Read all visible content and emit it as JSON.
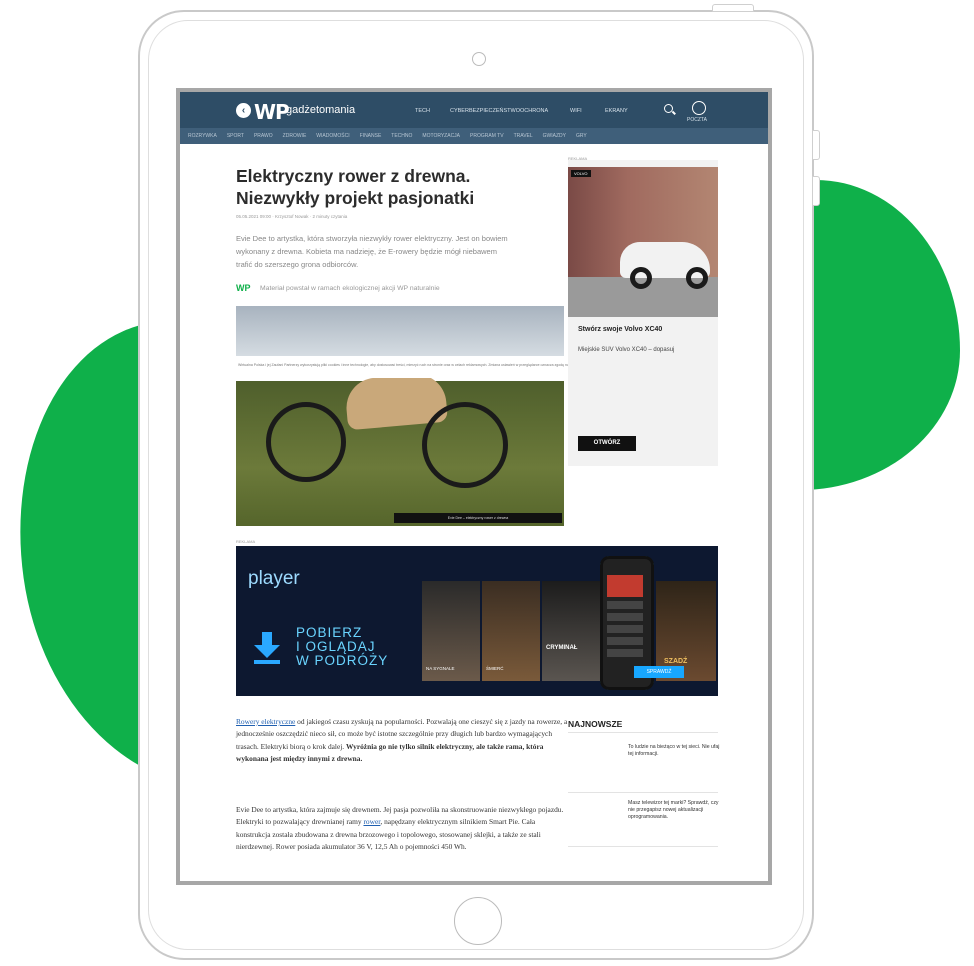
{
  "topbar": {
    "brand": "WP",
    "site_name": "gadżetomania",
    "nav": [
      "TECH",
      "CYBERBEZPIECZEŃSTWO",
      "OCHRONA",
      "WIFI",
      "EKRANY"
    ],
    "poczta": "POCZTA"
  },
  "subnav": [
    "ROZRYWKA",
    "SPORT",
    "PRAWO",
    "ZDROWIE",
    "WIADOMOŚCI",
    "FINANSE",
    "TECHNO",
    "MOTORYZACJA",
    "PROGRAM TV",
    "TRAVEL",
    "GWIAZDY",
    "GRY"
  ],
  "article": {
    "title": "Elektryczny rower z drewna. Niezwykły projekt pasjonatki",
    "meta": "05.05.2021 09:00 · Krzysztof Nowak · 2 minuty czytania",
    "lead": "Evie Dee to artystka, która stworzyła niezwykły rower elektryczny. Jest on bowiem wykonany z drewna. Kobieta ma nadzieję, że E-rowery będzie mógł niebawem trafić do szerszego grona odbiorców.",
    "promo_mark": "WP",
    "promo_text": "Materiał powstał w ramach ekologicznej akcji WP naturalnie",
    "consent_text": "Wirtualna Polska i jej Zaufani Partnerzy wykorzystują pliki cookies i inne technologie, aby dostosować treści, mierzyć ruch na stronie oraz w celach reklamowych. Zmiana ustawień w przeglądarce oznacza zgodę na ich zapisywanie. Szczegóły w Polityce prywatności.",
    "photo_caption": "Evie Dee – elektryczny rower z drewna",
    "body_p1_link": "Rowery elektryczne",
    "body_p1": " od jakiegoś czasu zyskują na popularności. Pozwalają one cieszyć się z jazdy na rowerze, a jednocześnie oszczędzić nieco sił, co może być istotne szczególnie przy długich lub bardzo wymagających trasach. Elektryki biorą o krok dalej. ",
    "body_p1_bold": "Wyróżnia go nie tylko silnik elektryczny, ale także rama, która wykonana jest między innymi z drewna.",
    "body_p2_a": "Evie Dee to artystka, która zajmuje się drewnem. Jej pasja pozwoliła na skonstruowanie niezwykłego pojazdu. Elektryki to pozwalający drewnianej ramy ",
    "body_p2_link": "rower",
    "body_p2_b": ", napędzany elektrycznym silnikiem Smart Pie. Cała konstrukcja została zbudowana z drewna brzozowego i topolowego, stosowanej sklejki, a także ze stali nierdzewnej. Rower posiada akumulator 36 V, 12,5 Ah o pojemności 450 Wh."
  },
  "sidebar_ad": {
    "tag": "REKLAMA",
    "badge": "VOLVO",
    "title": "Stwórz swoje Volvo XC40",
    "text": "Miejskie SUV Volvo XC40 – dopasuj",
    "cta": "OTWÓRZ"
  },
  "banner": {
    "tag": "REKLAMA",
    "logo": "player",
    "line1": "POBIERZ",
    "line2": "I OGLĄDAJ",
    "line3": "W PODRÓŻY",
    "poster1": "NA SYGNALE",
    "poster2": "ŚMIERĆ",
    "poster3": "CRYMINAŁ",
    "poster4": "SZADŹ",
    "cta": "SPRAWDŹ"
  },
  "latest": {
    "heading": "NAJNOWSZE",
    "items": [
      "To ludzie na bieżąco w tej sieci. Nie ufaj tej informacji.",
      "Masz telewizor tej marki? Sprawdź, czy nie przegapisz nowej aktualizacji oprogramowania."
    ]
  },
  "colors": {
    "brand_green": "#0fb04a",
    "header_blue": "#2e4d66",
    "banner_bg": "#0d1830",
    "banner_accent": "#6ad4ff"
  }
}
